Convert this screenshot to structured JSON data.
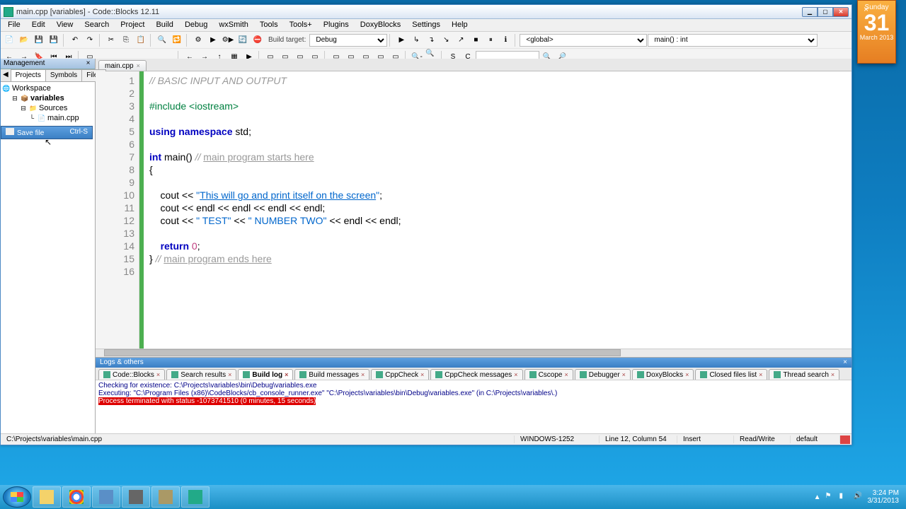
{
  "window": {
    "title": "main.cpp [variables] - Code::Blocks 12.11"
  },
  "menubar": [
    "File",
    "Edit",
    "View",
    "Search",
    "Project",
    "Build",
    "Debug",
    "wxSmith",
    "Tools",
    "Tools+",
    "Plugins",
    "DoxyBlocks",
    "Settings",
    "Help"
  ],
  "toolbar": {
    "build_target_label": "Build target:",
    "build_target": "Debug",
    "scope": "<global>",
    "func": "main() : int"
  },
  "management": {
    "title": "Management",
    "tabs": [
      "Projects",
      "Symbols",
      "Files"
    ],
    "tree": {
      "workspace": "Workspace",
      "project": "variables",
      "folder": "Sources",
      "file": "main.cpp"
    },
    "context_item": "Save file",
    "context_shortcut": "Ctrl-S"
  },
  "editor": {
    "tab": "main.cpp",
    "lines": [
      {
        "n": 1,
        "segs": [
          {
            "t": "// BASIC INPUT AND OUTPUT",
            "c": "c-com"
          }
        ]
      },
      {
        "n": 2,
        "segs": []
      },
      {
        "n": 3,
        "segs": [
          {
            "t": "#include <iostream>",
            "c": "c-pre"
          }
        ]
      },
      {
        "n": 4,
        "segs": []
      },
      {
        "n": 5,
        "segs": [
          {
            "t": "using",
            "c": "c-kw"
          },
          {
            "t": " ",
            "c": ""
          },
          {
            "t": "namespace",
            "c": "c-kw"
          },
          {
            "t": " std;",
            "c": ""
          }
        ]
      },
      {
        "n": 6,
        "segs": []
      },
      {
        "n": 7,
        "segs": [
          {
            "t": "int",
            "c": "c-kw"
          },
          {
            "t": " main() ",
            "c": ""
          },
          {
            "t": "// ",
            "c": "c-com"
          },
          {
            "t": "main program starts here",
            "c": "c-com-u"
          }
        ]
      },
      {
        "n": 8,
        "segs": [
          {
            "t": "{",
            "c": ""
          }
        ]
      },
      {
        "n": 9,
        "segs": []
      },
      {
        "n": 10,
        "segs": [
          {
            "t": "    cout << ",
            "c": ""
          },
          {
            "t": "\"",
            "c": "c-str"
          },
          {
            "t": "This will go and print itself on the screen",
            "c": "c-str-u"
          },
          {
            "t": "\"",
            "c": "c-str"
          },
          {
            "t": ";",
            "c": ""
          }
        ]
      },
      {
        "n": 11,
        "segs": [
          {
            "t": "    cout << endl << endl << endl << endl;",
            "c": ""
          }
        ]
      },
      {
        "n": 12,
        "segs": [
          {
            "t": "    cout << ",
            "c": ""
          },
          {
            "t": "\" TEST\"",
            "c": "c-str"
          },
          {
            "t": " << ",
            "c": ""
          },
          {
            "t": "\" NUMBER TWO\"",
            "c": "c-str"
          },
          {
            "t": " << endl << endl;",
            "c": ""
          }
        ]
      },
      {
        "n": 13,
        "segs": []
      },
      {
        "n": 14,
        "segs": [
          {
            "t": "    ",
            "c": ""
          },
          {
            "t": "return",
            "c": "c-kw"
          },
          {
            "t": " ",
            "c": ""
          },
          {
            "t": "0",
            "c": "c-num"
          },
          {
            "t": ";",
            "c": ""
          }
        ]
      },
      {
        "n": 15,
        "segs": [
          {
            "t": "} ",
            "c": ""
          },
          {
            "t": "// ",
            "c": "c-com"
          },
          {
            "t": "main program ends here",
            "c": "c-com-u"
          }
        ]
      },
      {
        "n": 16,
        "segs": []
      }
    ]
  },
  "log": {
    "title": "Logs & others",
    "tabs": [
      "Code::Blocks",
      "Search results",
      "Build log",
      "Build messages",
      "CppCheck",
      "CppCheck messages",
      "Cscope",
      "Debugger",
      "DoxyBlocks",
      "Closed files list",
      "Thread search"
    ],
    "active_tab": 2,
    "lines": [
      {
        "t": "Checking for existence: C:\\Projects\\variables\\bin\\Debug\\variables.exe",
        "c": ""
      },
      {
        "t": "Executing: \"C:\\Program Files (x86)\\CodeBlocks/cb_console_runner.exe\" \"C:\\Projects\\variables\\bin\\Debug\\variables.exe\"  (in C:\\Projects\\variables\\.)",
        "c": ""
      },
      {
        "t": "Process terminated with status -1073741510 (0 minutes, 15 seconds)",
        "c": "err"
      }
    ]
  },
  "status": {
    "path": "C:\\Projects\\variables\\main.cpp",
    "encoding": "WINDOWS-1252",
    "pos": "Line 12, Column 54",
    "mode1": "Insert",
    "mode2": "Read/Write",
    "mode3": "default"
  },
  "calendar": {
    "day": "Sunday",
    "date": "31",
    "month_year": "March 2013"
  },
  "tray": {
    "time": "3:24 PM",
    "date": "3/31/2013"
  }
}
